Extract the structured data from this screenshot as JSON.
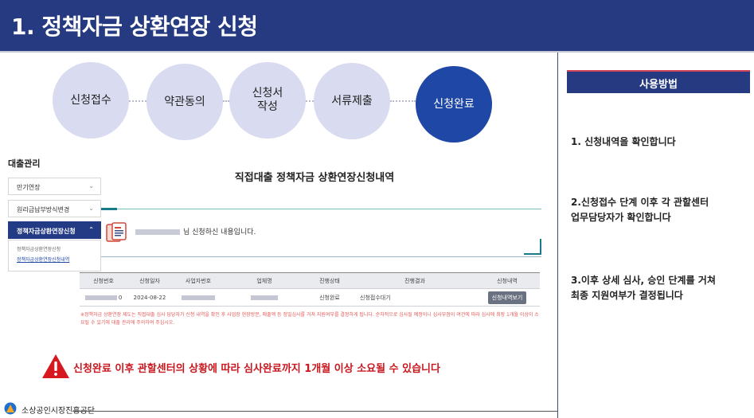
{
  "header": {
    "title": "1. 정책자금 상환연장 신청"
  },
  "steps": [
    {
      "label": "신청접수",
      "active": false
    },
    {
      "label": "약관동의",
      "active": false
    },
    {
      "label": "신청서\n작성",
      "active": false
    },
    {
      "label": "서류제출",
      "active": false
    },
    {
      "label": "신청완료",
      "active": true
    }
  ],
  "sidebar": {
    "title": "대출관리",
    "items": [
      {
        "label": "만기연장"
      },
      {
        "label": "원리금납부방식변경"
      },
      {
        "label": "정책자금상환연장신청"
      }
    ],
    "subitems": [
      {
        "label": "정책자금상환연장신청"
      },
      {
        "label": "정책자금상환연장신청내역"
      }
    ]
  },
  "main": {
    "title": "직접대출 정책자금 상환연장신청내역",
    "notice": "님 신청하신 내용입니다."
  },
  "table": {
    "headers": [
      "신청번호",
      "신청일자",
      "사업자번호",
      "업체명",
      "진행상태",
      "진행결과",
      "신청내역"
    ],
    "row": {
      "number_suffix": "0",
      "date": "2024-08-22",
      "status": "신청완료",
      "result": "신청접수대기",
      "button": "신청내역보기"
    }
  },
  "footnote": "※정책자금 상환연장 제도는 직접대출 심사 담당자가 신청 내역을 확인 후 사업장 현장방문, 매출액 등 정밀심사를 거쳐 지원여부를 결정하게 됩니다. 순차적으로 심사될 예정이니 심사부점이 여건에 따라 심사에 최장 1개월 이상이 소요될 수 있기에 대출 관리에 주의하여 주십시오.",
  "warning": "신청완료 이후 관할센터의 상황에 따라 심사완료까지 1개월 이상 소요될 수 있습니다",
  "footer": {
    "org": "소상공인시장진흥공단"
  },
  "right_panel": {
    "title": "사용방법",
    "steps": [
      "1. 신청내역을 확인합니다",
      "2.신청접수 단계 이후 각 관할센터\n   업무담당자가 확인합니다",
      "3.이후 상세 심사, 승인 단계를 거쳐\n   최종 지원여부가 결정됩니다"
    ]
  },
  "colors": {
    "header": "#253a80",
    "step_active": "#1f47a5",
    "step_inactive": "#d9dbf0",
    "warning": "#c8171e"
  }
}
